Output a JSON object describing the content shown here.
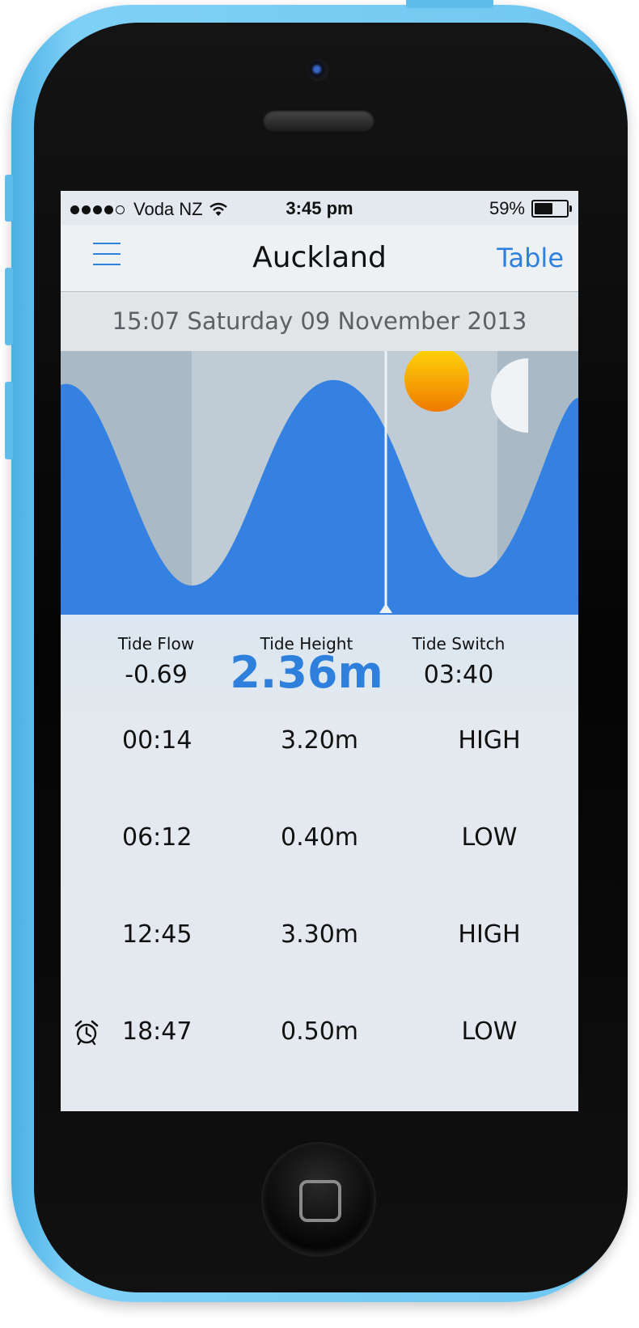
{
  "status_bar": {
    "carrier": "Voda NZ",
    "time": "3:45 pm",
    "battery_percent": "59%",
    "battery_level": 0.59,
    "signal_dots_filled": 4,
    "signal_dots_total": 5,
    "wifi_icon": "wifi-icon"
  },
  "nav": {
    "menu_icon": "hamburger-menu-icon",
    "title": "Auckland",
    "right_button": "Table"
  },
  "date_line": "15:07 Saturday 09 November 2013",
  "chart": {
    "sun_icon": "sun-icon",
    "moon_icon": "half-moon-icon",
    "wave_color": "#3481e2",
    "background_color": "#bcc9d2"
  },
  "info": {
    "tide_flow_label": "Tide Flow",
    "tide_flow_value": "-0.69",
    "tide_height_label": "Tide Height",
    "tide_height_value": "2.36m",
    "tide_switch_label": "Tide Switch",
    "tide_switch_value": "03:40"
  },
  "tides": [
    {
      "time": "00:14",
      "height": "3.20m",
      "type": "HIGH",
      "alarm": false
    },
    {
      "time": "06:12",
      "height": "0.40m",
      "type": "LOW",
      "alarm": false
    },
    {
      "time": "12:45",
      "height": "3.30m",
      "type": "HIGH",
      "alarm": false
    },
    {
      "time": "18:47",
      "height": "0.50m",
      "type": "LOW",
      "alarm": true
    }
  ],
  "colors": {
    "accent": "#2f80dc",
    "phone_shell": "#6cc6f1"
  }
}
